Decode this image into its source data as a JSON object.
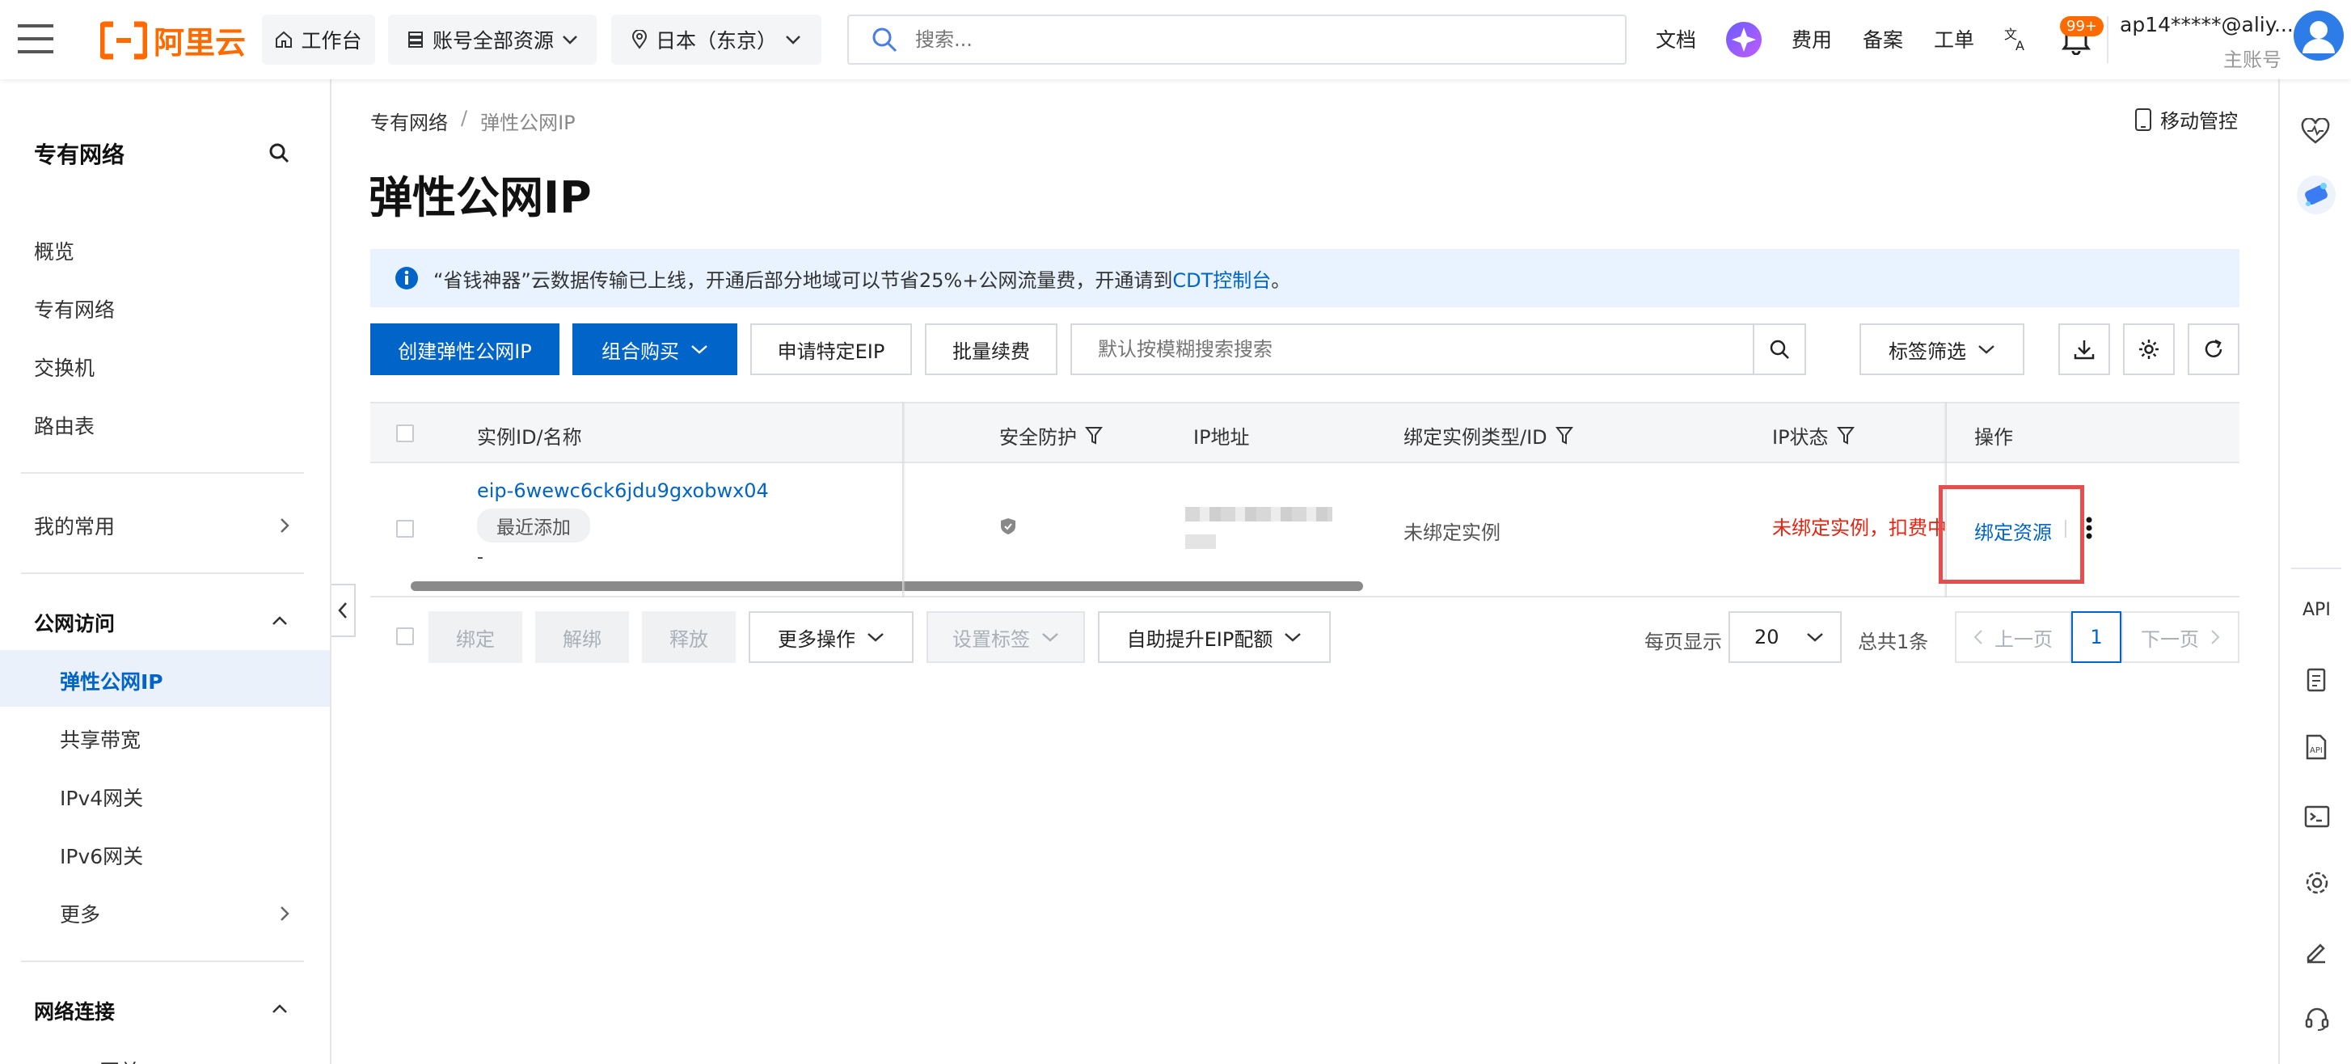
{
  "header": {
    "brand": "阿里云",
    "workbench": "工作台",
    "resources": "账号全部资源",
    "region": "日本（东京）",
    "search_placeholder": "搜索...",
    "docs": "文档",
    "billing": "费用",
    "filing": "备案",
    "tickets": "工单",
    "notif_badge": "99+",
    "account_name": "ap14*****@aliy...",
    "account_role": "主账号"
  },
  "sidebar": {
    "title": "专有网络",
    "items": [
      "概览",
      "专有网络",
      "交换机",
      "路由表"
    ],
    "favorites": "我的常用",
    "section_public": "公网访问",
    "public_items": [
      "弹性公网IP",
      "共享带宽",
      "IPv4网关",
      "IPv6网关",
      "更多"
    ],
    "section_network": "网络连接",
    "cut_item": "NAT网关"
  },
  "breadcrumb": {
    "root": "专有网络",
    "sep": "/",
    "current": "弹性公网IP"
  },
  "mobile_control": "移动管控",
  "page_title": "弹性公网IP",
  "notice": {
    "text_before": "“省钱神器”云数据传输已上线，开通后部分地域可以节省25%+公网流量费，开通请到",
    "link": "CDT控制台",
    "text_after": "。"
  },
  "toolbar": {
    "create": "创建弹性公网IP",
    "combo": "组合购买",
    "apply_eip": "申请特定EIP",
    "batch_renew": "批量续费",
    "search_placeholder": "默认按模糊搜索搜索",
    "tag_filter": "标签筛选"
  },
  "table": {
    "columns": {
      "instance": "实例ID/名称",
      "security": "安全防护",
      "ip": "IP地址",
      "bound": "绑定实例类型/ID",
      "status": "IP状态",
      "actions": "操作"
    },
    "rows": [
      {
        "id": "eip-6wewc6ck6jdu9gxobwx04",
        "tag": "最近添加",
        "name": "-",
        "bound": "未绑定实例",
        "status": "未绑定实例，扣费中",
        "action": "绑定资源"
      }
    ]
  },
  "footer": {
    "bind": "绑定",
    "unbind": "解绑",
    "release": "释放",
    "more_ops": "更多操作",
    "set_tags": "设置标签",
    "quota": "自助提升EIP配额",
    "per_page_label": "每页显示",
    "per_page": "20",
    "total": "总共1条",
    "prev": "上一页",
    "page": "1",
    "next": "下一页"
  },
  "rail": {
    "api_label": "API"
  },
  "colors": {
    "primary": "#0064c8",
    "accent": "#ff6a00",
    "danger": "#e62412",
    "notice_bg": "#e8f3ff",
    "highlight": "#e84d4d"
  }
}
